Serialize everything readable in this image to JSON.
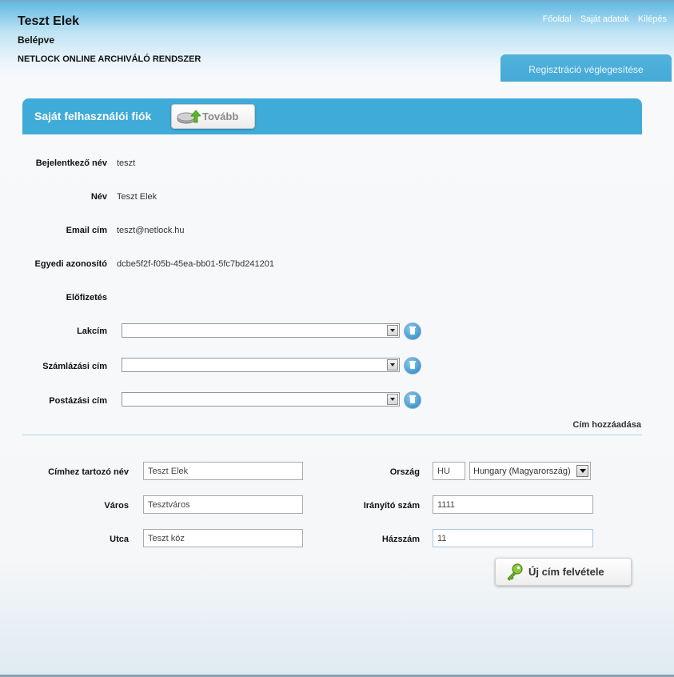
{
  "header": {
    "user_name": "Teszt Elek",
    "status": "Belépve",
    "system_name": "NETLOCK ONLINE ARCHIVÁLÓ RENDSZER",
    "nav": [
      "Főoldal",
      "Saját adatok",
      "Kilépés"
    ],
    "tab_finalize": "Regisztráció véglegesítése"
  },
  "panel": {
    "title": "Saját felhasználói fiók",
    "next_button": "Tovább",
    "next_icon": "disk-upload-icon"
  },
  "account": {
    "login_label": "Bejelentkező név",
    "login_value": "teszt",
    "name_label": "Név",
    "name_value": "Teszt Elek",
    "email_label": "Email cím",
    "email_value": "teszt@netlock.hu",
    "uid_label": "Egyedi azonosító",
    "uid_value": "dcbe5f2f-f05b-45ea-bb01-5fc7bd241201",
    "subscription_label": "Előfizetés"
  },
  "addresses": {
    "home_label": "Lakcím",
    "billing_label": "Számlázási cím",
    "postal_label": "Postázási cím",
    "add_link": "Cím hozzáadása"
  },
  "form": {
    "contact_name_label": "Címhez tartozó név",
    "contact_name_value": "Teszt Elek",
    "city_label": "Város",
    "city_value": "Tesztváros",
    "street_label": "Utca",
    "street_value": "Teszt köz",
    "country_label": "Ország",
    "country_code": "HU",
    "country_name": "Hungary (Magyarország)",
    "zip_label": "Irányító szám",
    "zip_value": "1111",
    "house_label": "Házszám",
    "house_value": "11",
    "submit_button": "Új cím felvétele",
    "submit_icon": "key-icon"
  },
  "colors": {
    "accent": "#3fabd8",
    "tab": "#45a9d6"
  }
}
